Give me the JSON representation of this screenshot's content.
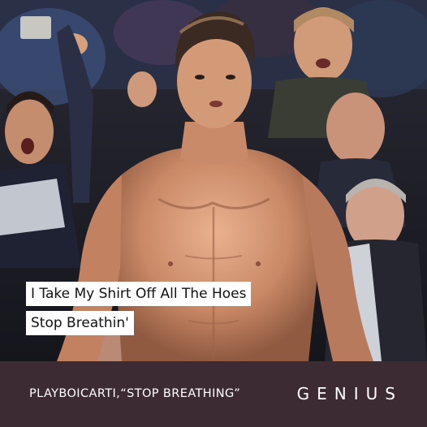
{
  "lyric": {
    "line1": "I Take My Shirt Off All The Hoes",
    "line2": "Stop Breathin'"
  },
  "footer": {
    "credit": "PLAYBOICARTI,“STOP BREATHING”",
    "logo": "GENIUS"
  },
  "colors": {
    "footer_bg": "#3c2b33",
    "caption_bg": "#ffffff",
    "caption_text": "#111111"
  }
}
